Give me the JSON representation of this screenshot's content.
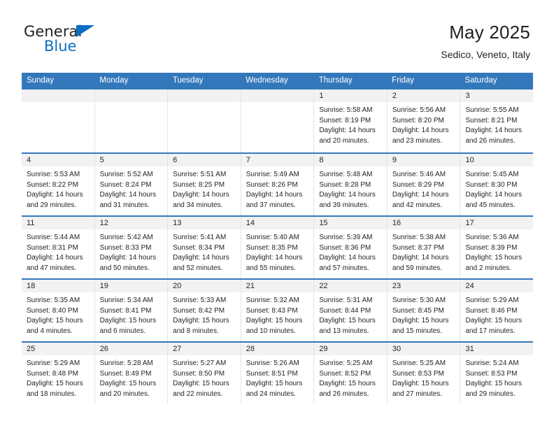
{
  "brand": {
    "name_part1": "General",
    "name_part2": "Blue",
    "flag_icon": "triangle-flag-icon"
  },
  "header": {
    "title": "May 2025",
    "location": "Sedico, Veneto, Italy"
  },
  "colors": {
    "header_blue": "#3478bc",
    "brand_blue": "#0a6fc2",
    "day_head_bg": "#f2f2f2",
    "cell_border": "#e4e4e4",
    "text": "#231f20"
  },
  "calendar": {
    "weekdays": [
      "Sunday",
      "Monday",
      "Tuesday",
      "Wednesday",
      "Thursday",
      "Friday",
      "Saturday"
    ],
    "weeks": [
      [
        {
          "day": "",
          "lines": []
        },
        {
          "day": "",
          "lines": []
        },
        {
          "day": "",
          "lines": []
        },
        {
          "day": "",
          "lines": []
        },
        {
          "day": "1",
          "lines": [
            "Sunrise: 5:58 AM",
            "Sunset: 8:19 PM",
            "Daylight: 14 hours",
            "and 20 minutes."
          ]
        },
        {
          "day": "2",
          "lines": [
            "Sunrise: 5:56 AM",
            "Sunset: 8:20 PM",
            "Daylight: 14 hours",
            "and 23 minutes."
          ]
        },
        {
          "day": "3",
          "lines": [
            "Sunrise: 5:55 AM",
            "Sunset: 8:21 PM",
            "Daylight: 14 hours",
            "and 26 minutes."
          ]
        }
      ],
      [
        {
          "day": "4",
          "lines": [
            "Sunrise: 5:53 AM",
            "Sunset: 8:22 PM",
            "Daylight: 14 hours",
            "and 29 minutes."
          ]
        },
        {
          "day": "5",
          "lines": [
            "Sunrise: 5:52 AM",
            "Sunset: 8:24 PM",
            "Daylight: 14 hours",
            "and 31 minutes."
          ]
        },
        {
          "day": "6",
          "lines": [
            "Sunrise: 5:51 AM",
            "Sunset: 8:25 PM",
            "Daylight: 14 hours",
            "and 34 minutes."
          ]
        },
        {
          "day": "7",
          "lines": [
            "Sunrise: 5:49 AM",
            "Sunset: 8:26 PM",
            "Daylight: 14 hours",
            "and 37 minutes."
          ]
        },
        {
          "day": "8",
          "lines": [
            "Sunrise: 5:48 AM",
            "Sunset: 8:28 PM",
            "Daylight: 14 hours",
            "and 39 minutes."
          ]
        },
        {
          "day": "9",
          "lines": [
            "Sunrise: 5:46 AM",
            "Sunset: 8:29 PM",
            "Daylight: 14 hours",
            "and 42 minutes."
          ]
        },
        {
          "day": "10",
          "lines": [
            "Sunrise: 5:45 AM",
            "Sunset: 8:30 PM",
            "Daylight: 14 hours",
            "and 45 minutes."
          ]
        }
      ],
      [
        {
          "day": "11",
          "lines": [
            "Sunrise: 5:44 AM",
            "Sunset: 8:31 PM",
            "Daylight: 14 hours",
            "and 47 minutes."
          ]
        },
        {
          "day": "12",
          "lines": [
            "Sunrise: 5:42 AM",
            "Sunset: 8:33 PM",
            "Daylight: 14 hours",
            "and 50 minutes."
          ]
        },
        {
          "day": "13",
          "lines": [
            "Sunrise: 5:41 AM",
            "Sunset: 8:34 PM",
            "Daylight: 14 hours",
            "and 52 minutes."
          ]
        },
        {
          "day": "14",
          "lines": [
            "Sunrise: 5:40 AM",
            "Sunset: 8:35 PM",
            "Daylight: 14 hours",
            "and 55 minutes."
          ]
        },
        {
          "day": "15",
          "lines": [
            "Sunrise: 5:39 AM",
            "Sunset: 8:36 PM",
            "Daylight: 14 hours",
            "and 57 minutes."
          ]
        },
        {
          "day": "16",
          "lines": [
            "Sunrise: 5:38 AM",
            "Sunset: 8:37 PM",
            "Daylight: 14 hours",
            "and 59 minutes."
          ]
        },
        {
          "day": "17",
          "lines": [
            "Sunrise: 5:36 AM",
            "Sunset: 8:39 PM",
            "Daylight: 15 hours",
            "and 2 minutes."
          ]
        }
      ],
      [
        {
          "day": "18",
          "lines": [
            "Sunrise: 5:35 AM",
            "Sunset: 8:40 PM",
            "Daylight: 15 hours",
            "and 4 minutes."
          ]
        },
        {
          "day": "19",
          "lines": [
            "Sunrise: 5:34 AM",
            "Sunset: 8:41 PM",
            "Daylight: 15 hours",
            "and 6 minutes."
          ]
        },
        {
          "day": "20",
          "lines": [
            "Sunrise: 5:33 AM",
            "Sunset: 8:42 PM",
            "Daylight: 15 hours",
            "and 8 minutes."
          ]
        },
        {
          "day": "21",
          "lines": [
            "Sunrise: 5:32 AM",
            "Sunset: 8:43 PM",
            "Daylight: 15 hours",
            "and 10 minutes."
          ]
        },
        {
          "day": "22",
          "lines": [
            "Sunrise: 5:31 AM",
            "Sunset: 8:44 PM",
            "Daylight: 15 hours",
            "and 13 minutes."
          ]
        },
        {
          "day": "23",
          "lines": [
            "Sunrise: 5:30 AM",
            "Sunset: 8:45 PM",
            "Daylight: 15 hours",
            "and 15 minutes."
          ]
        },
        {
          "day": "24",
          "lines": [
            "Sunrise: 5:29 AM",
            "Sunset: 8:46 PM",
            "Daylight: 15 hours",
            "and 17 minutes."
          ]
        }
      ],
      [
        {
          "day": "25",
          "lines": [
            "Sunrise: 5:29 AM",
            "Sunset: 8:48 PM",
            "Daylight: 15 hours",
            "and 18 minutes."
          ]
        },
        {
          "day": "26",
          "lines": [
            "Sunrise: 5:28 AM",
            "Sunset: 8:49 PM",
            "Daylight: 15 hours",
            "and 20 minutes."
          ]
        },
        {
          "day": "27",
          "lines": [
            "Sunrise: 5:27 AM",
            "Sunset: 8:50 PM",
            "Daylight: 15 hours",
            "and 22 minutes."
          ]
        },
        {
          "day": "28",
          "lines": [
            "Sunrise: 5:26 AM",
            "Sunset: 8:51 PM",
            "Daylight: 15 hours",
            "and 24 minutes."
          ]
        },
        {
          "day": "29",
          "lines": [
            "Sunrise: 5:25 AM",
            "Sunset: 8:52 PM",
            "Daylight: 15 hours",
            "and 26 minutes."
          ]
        },
        {
          "day": "30",
          "lines": [
            "Sunrise: 5:25 AM",
            "Sunset: 8:53 PM",
            "Daylight: 15 hours",
            "and 27 minutes."
          ]
        },
        {
          "day": "31",
          "lines": [
            "Sunrise: 5:24 AM",
            "Sunset: 8:53 PM",
            "Daylight: 15 hours",
            "and 29 minutes."
          ]
        }
      ]
    ]
  }
}
